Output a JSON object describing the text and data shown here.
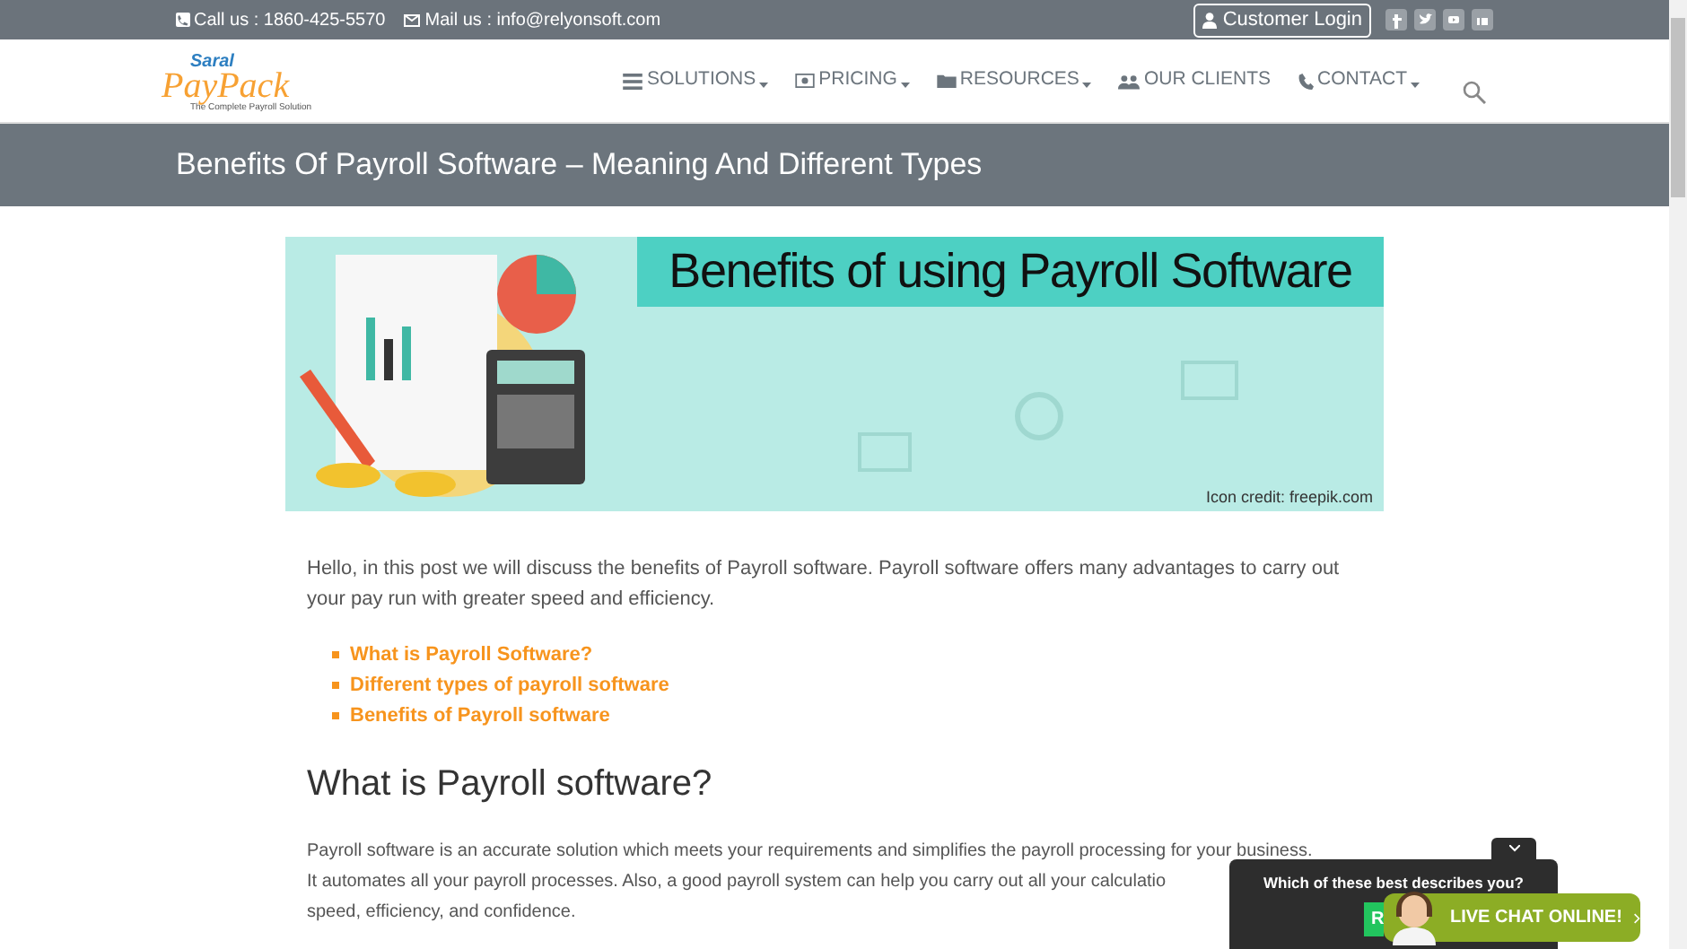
{
  "top_bar": {
    "phone": "Call us : 1860-425-5570",
    "email": "Mail us : info@relyonsoft.com",
    "login_button": "Customer Login"
  },
  "logo": {
    "top": "Saral",
    "main": "PayPack",
    "tagline": "The Complete Payroll Solution"
  },
  "nav": [
    {
      "label": "SOLUTIONS",
      "dropdown": true
    },
    {
      "label": "PRICING",
      "dropdown": true
    },
    {
      "label": "RESOURCES",
      "dropdown": true
    },
    {
      "label": "OUR CLIENTS",
      "dropdown": false
    },
    {
      "label": "CONTACT",
      "dropdown": true
    }
  ],
  "page_title": "Benefits Of Payroll Software – Meaning And Different Types",
  "banner": {
    "kind": "picture",
    "heading": "Benefits of using Payroll Software",
    "credit": "Icon credit: freepik.com"
  },
  "intro": "Hello, in this post we will discuss the benefits of Payroll software. Payroll software offers many advantages to carry out your pay run with greater speed and efficiency.",
  "toc": [
    "What is Payroll Software?",
    "Different types of payroll software",
    "Benefits of Payroll software"
  ],
  "section_heading": "What is Payroll software?",
  "section_lines": [
    "Payroll software is an accurate solution which meets your requirements and simplifies the payroll processing for your business.",
    "It automates all your payroll processes. Also, a good payroll system can help you carry out all your calculatio",
    "speed, efficiency, and confidence."
  ],
  "chat": {
    "question": "Which of these best describes you?",
    "option": "R",
    "live_button": "LIVE CHAT ONLINE!"
  }
}
